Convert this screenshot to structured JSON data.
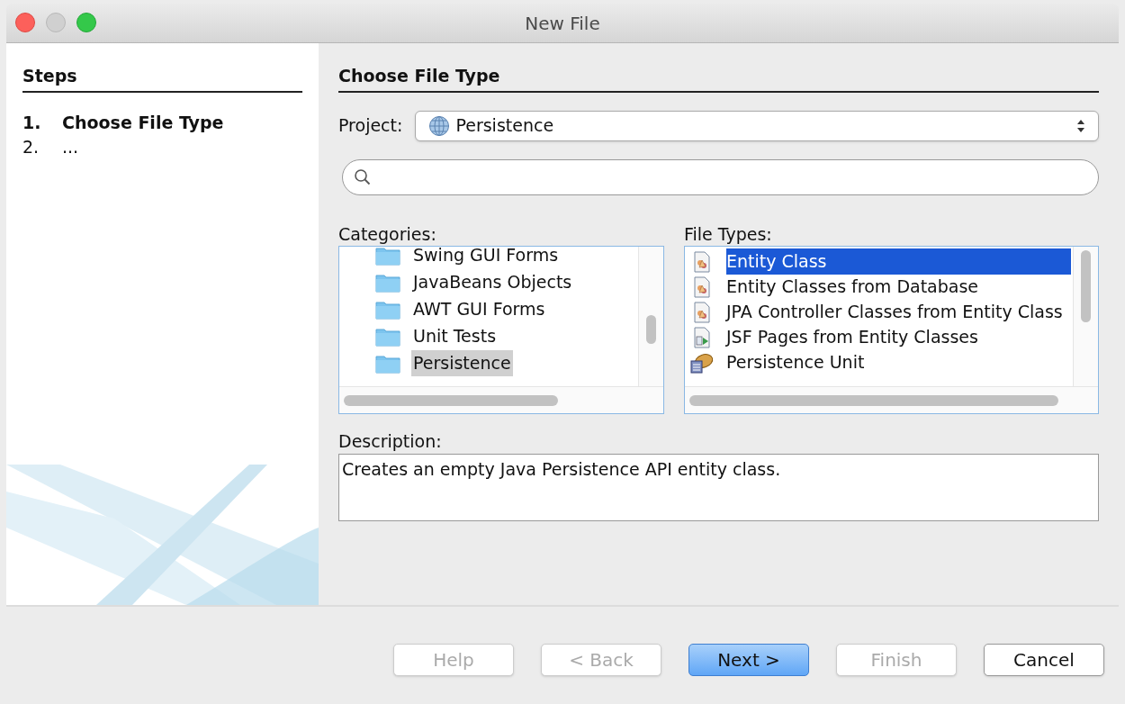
{
  "window": {
    "title": "New File"
  },
  "steps": {
    "title": "Steps",
    "items": [
      {
        "number": "1.",
        "label": "Choose File Type",
        "current": true
      },
      {
        "number": "2.",
        "label": "...",
        "current": false
      }
    ]
  },
  "panel": {
    "title": "Choose File Type",
    "project": {
      "label": "Project:",
      "value": "Persistence"
    }
  },
  "categories": {
    "label": "Categories:",
    "items": [
      {
        "label": "Swing GUI Forms",
        "selected": false
      },
      {
        "label": "JavaBeans Objects",
        "selected": false
      },
      {
        "label": "AWT GUI Forms",
        "selected": false
      },
      {
        "label": "Unit Tests",
        "selected": false
      },
      {
        "label": "Persistence",
        "selected": true
      }
    ]
  },
  "file_types": {
    "label": "File Types:",
    "items": [
      {
        "label": "Entity Class",
        "kind": "entity",
        "selected": true
      },
      {
        "label": "Entity Classes from Database",
        "kind": "entity",
        "selected": false
      },
      {
        "label": "JPA Controller Classes from Entity Class",
        "kind": "entity",
        "selected": false
      },
      {
        "label": "JSF Pages from Entity Classes",
        "kind": "jsf",
        "selected": false
      },
      {
        "label": "Persistence Unit",
        "kind": "unit",
        "selected": false
      }
    ]
  },
  "description": {
    "label": "Description:",
    "text": "Creates an empty Java Persistence API entity class."
  },
  "buttons": [
    {
      "label": "Help",
      "disabled": true,
      "default": false
    },
    {
      "label": "< Back",
      "disabled": true,
      "default": false
    },
    {
      "label": "Next >",
      "disabled": false,
      "default": true
    },
    {
      "label": "Finish",
      "disabled": true,
      "default": false
    },
    {
      "label": "Cancel",
      "disabled": false,
      "default": false
    }
  ]
}
